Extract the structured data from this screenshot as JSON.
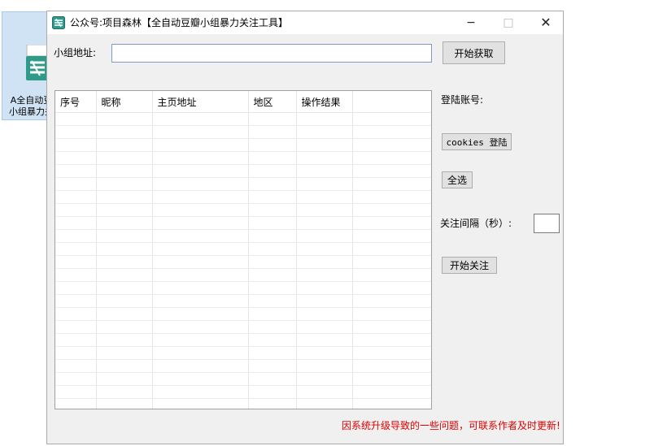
{
  "desktop": {
    "icon_label": "A全自动豆瓣小组暴力关注"
  },
  "window": {
    "title": "公众号:项目森林【全自动豆瓣小组暴力关注工具】",
    "controls": {
      "minimize": "−",
      "maximize": "□",
      "close": "✕"
    }
  },
  "form": {
    "group_url_label": "小组地址:",
    "group_url_value": "",
    "start_fetch_button": "开始获取"
  },
  "table": {
    "columns": [
      "序号",
      "昵称",
      "主页地址",
      "地区",
      "操作结果",
      ""
    ],
    "rows": []
  },
  "side": {
    "login_account_label": "登陆账号:",
    "cookies_login_button": "cookies 登陆",
    "select_all_button": "全选",
    "interval_label": "关注间隔（秒）:",
    "interval_value": "",
    "start_follow_button": "开始关注"
  },
  "status": {
    "text": "因系统升级导致的一些问题，可联系作者及时更新!",
    "color": "#e00000"
  },
  "colors": {
    "accent_input_border": "#7a9cc7",
    "window_bg": "#f0f0f0"
  },
  "icons": {
    "app": "app-logo-icon",
    "desktop": "desktop-app-icon"
  }
}
